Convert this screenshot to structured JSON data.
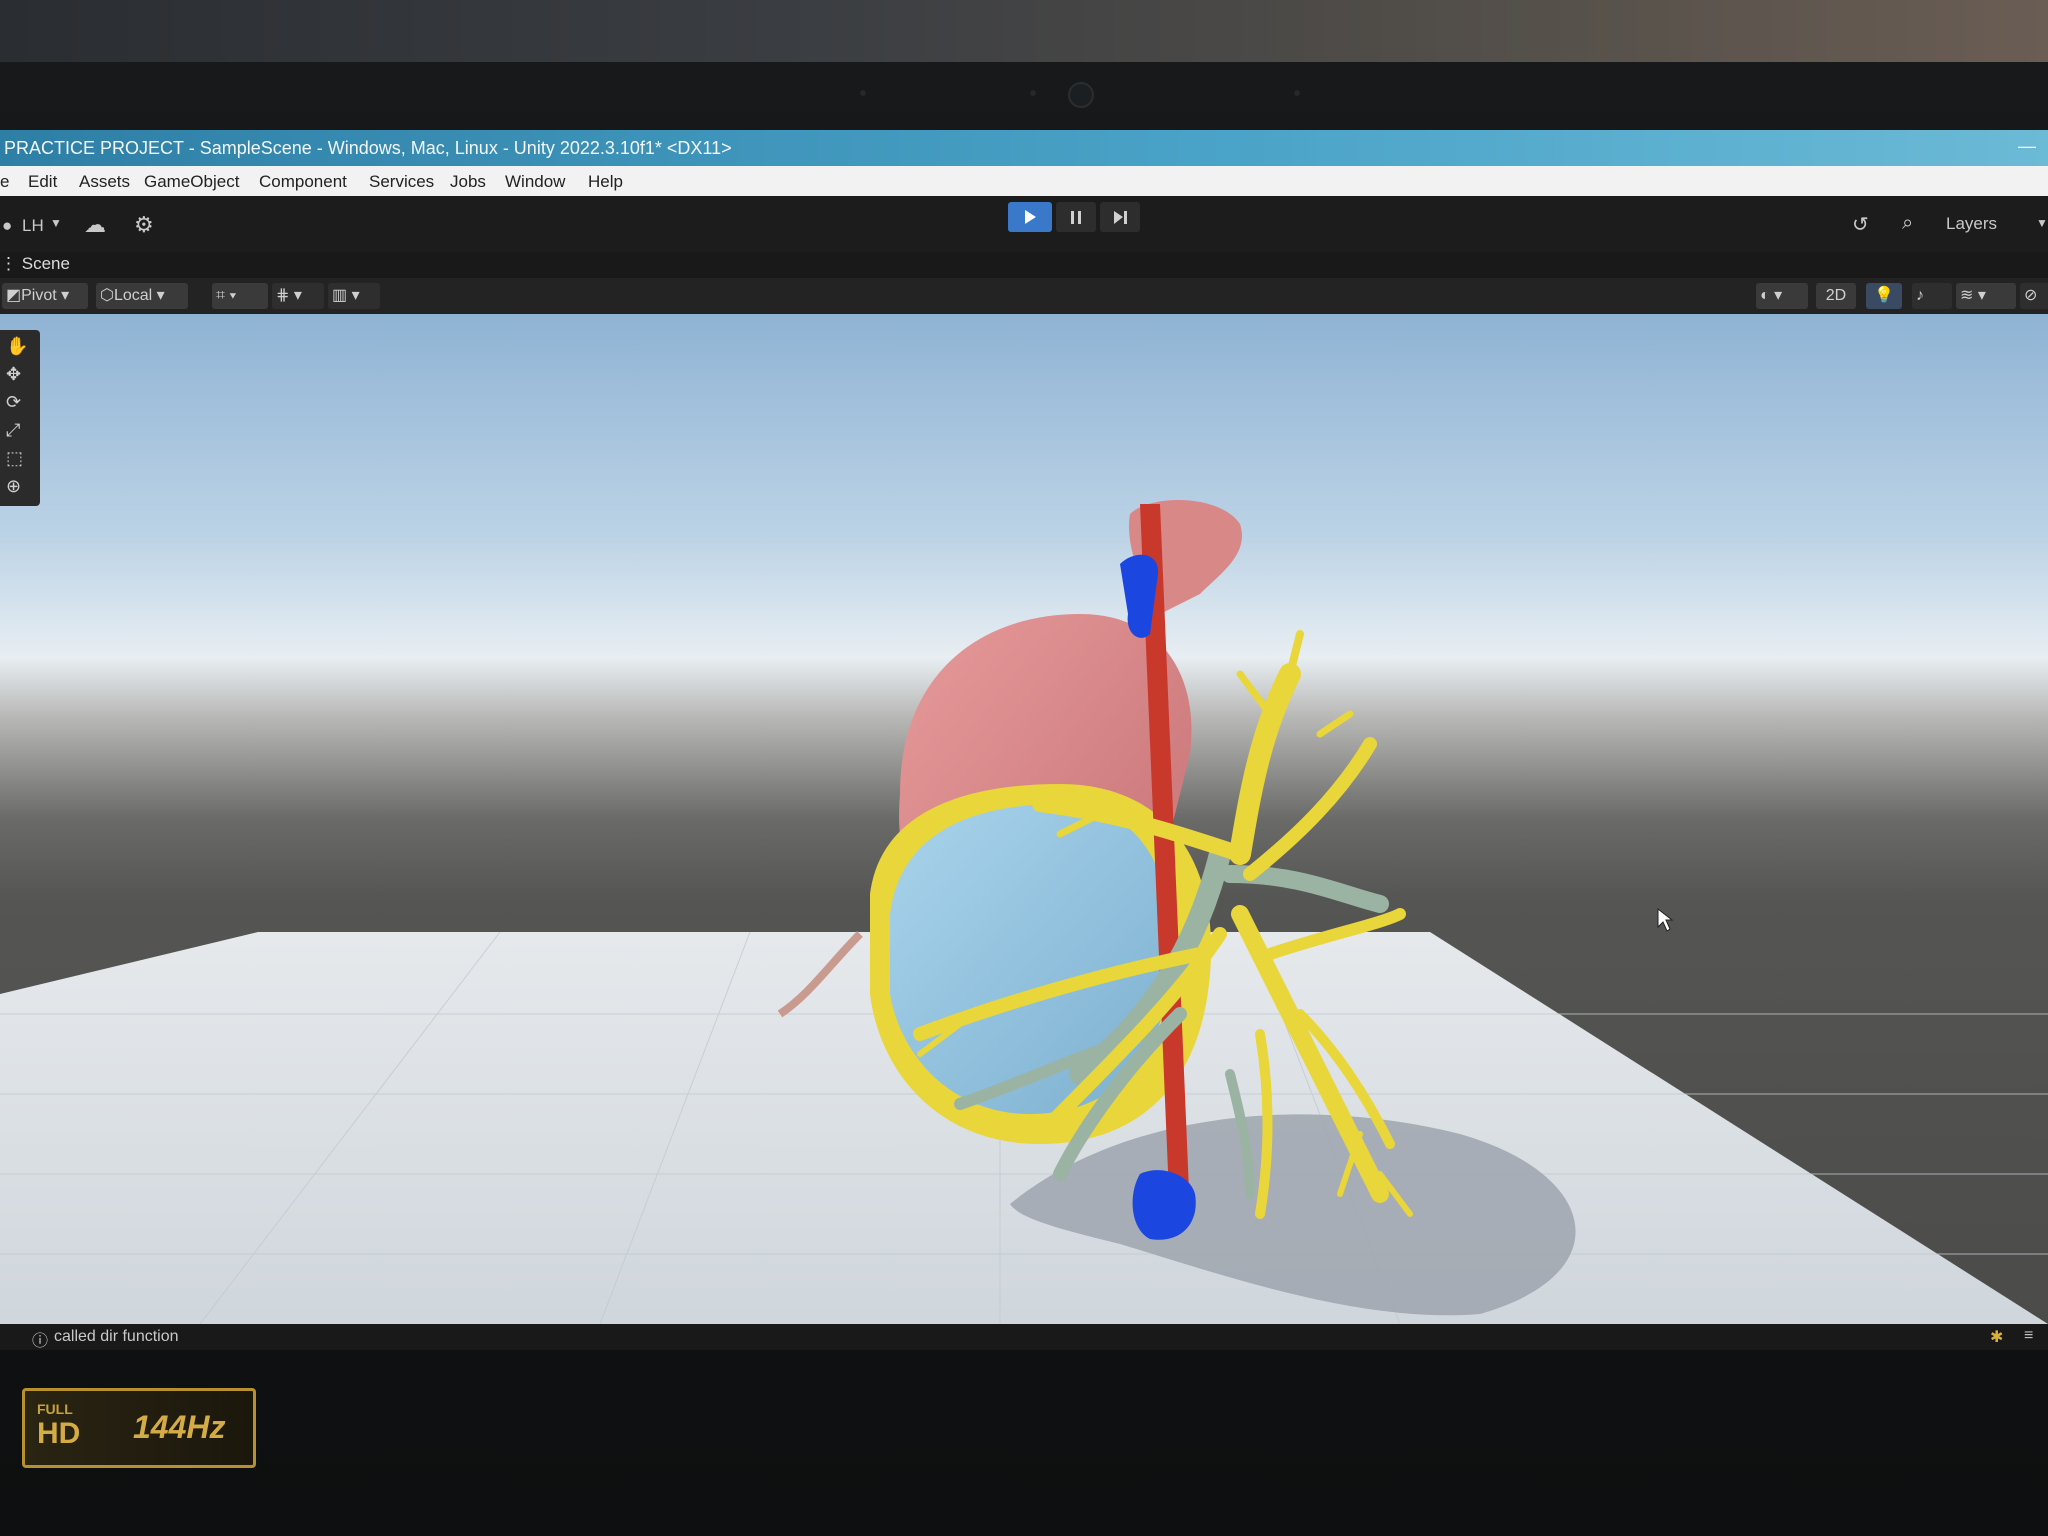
{
  "window": {
    "title": "PRACTICE PROJECT - SampleScene - Windows, Mac, Linux - Unity 2022.3.10f1* <DX11>",
    "minimize_glyph": "—"
  },
  "menu": {
    "items": [
      "e",
      "Edit",
      "Assets",
      "GameObject",
      "Component",
      "Services",
      "Jobs",
      "Window",
      "Help"
    ]
  },
  "toolbar": {
    "account_label": "LH",
    "layers_label": "Layers",
    "icons": [
      "account-icon",
      "cloud-icon",
      "settings-icon",
      "play-icon",
      "pause-icon",
      "step-icon",
      "history-icon",
      "search-icon"
    ]
  },
  "scene_tab": {
    "label": "Scene"
  },
  "scene_tools": {
    "pivot_label": "Pivot",
    "local_label": "Local",
    "mode_2d_label": "2D"
  },
  "status": {
    "message": "called dir function"
  },
  "sticker": {
    "line1": "FULL",
    "line2": "HD",
    "refresh": "144Hz"
  },
  "colors": {
    "play_active": "#3a78c9",
    "titlebar": "#3b93bb",
    "heart_red": "#d98b8b",
    "heart_blue": "#8fc2df",
    "bronchi_yellow": "#e8d63a",
    "vessel_gray": "#9bb3a3",
    "aorta_red": "#c8392b",
    "vein_blue": "#1c46e0"
  }
}
